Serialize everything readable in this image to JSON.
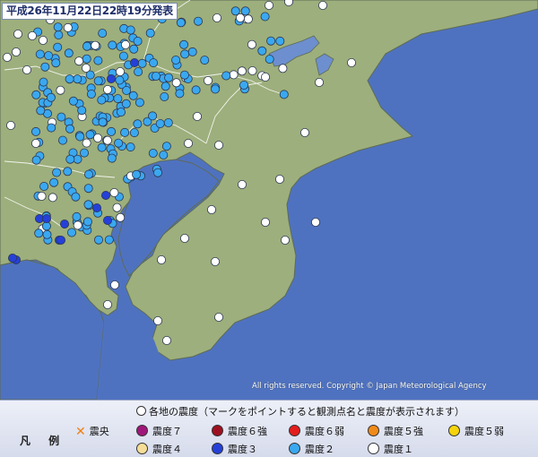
{
  "header": {
    "title": "平成26年11月22日22時19分発表"
  },
  "map": {
    "copyright": "All rights reserved. Copyright © Japan Meteorological Agency",
    "colors": {
      "sea": "#4f72c0",
      "land": "#9daf7c",
      "coast": "#5d6b56",
      "border": "#ffffff",
      "lake": "#6d8fcf"
    }
  },
  "legend": {
    "caption": "凡 例",
    "epicenter_label": "震央",
    "heading": "各地の震度（マークをポイントすると観測点名と震度が表示されます）",
    "items": [
      {
        "label": "震度７",
        "color": "#a0177a"
      },
      {
        "label": "震度６強",
        "color": "#9e1020"
      },
      {
        "label": "震度６弱",
        "color": "#e41d1d"
      },
      {
        "label": "震度５強",
        "color": "#f08a18"
      },
      {
        "label": "震度５弱",
        "color": "#f5d40e"
      },
      {
        "label": "震度４",
        "color": "#f5dd98"
      },
      {
        "label": "震度３",
        "color": "#2540d8"
      },
      {
        "label": "震度２",
        "color": "#3aa8f0"
      },
      {
        "label": "震度１",
        "color": "#ffffff"
      }
    ]
  }
}
